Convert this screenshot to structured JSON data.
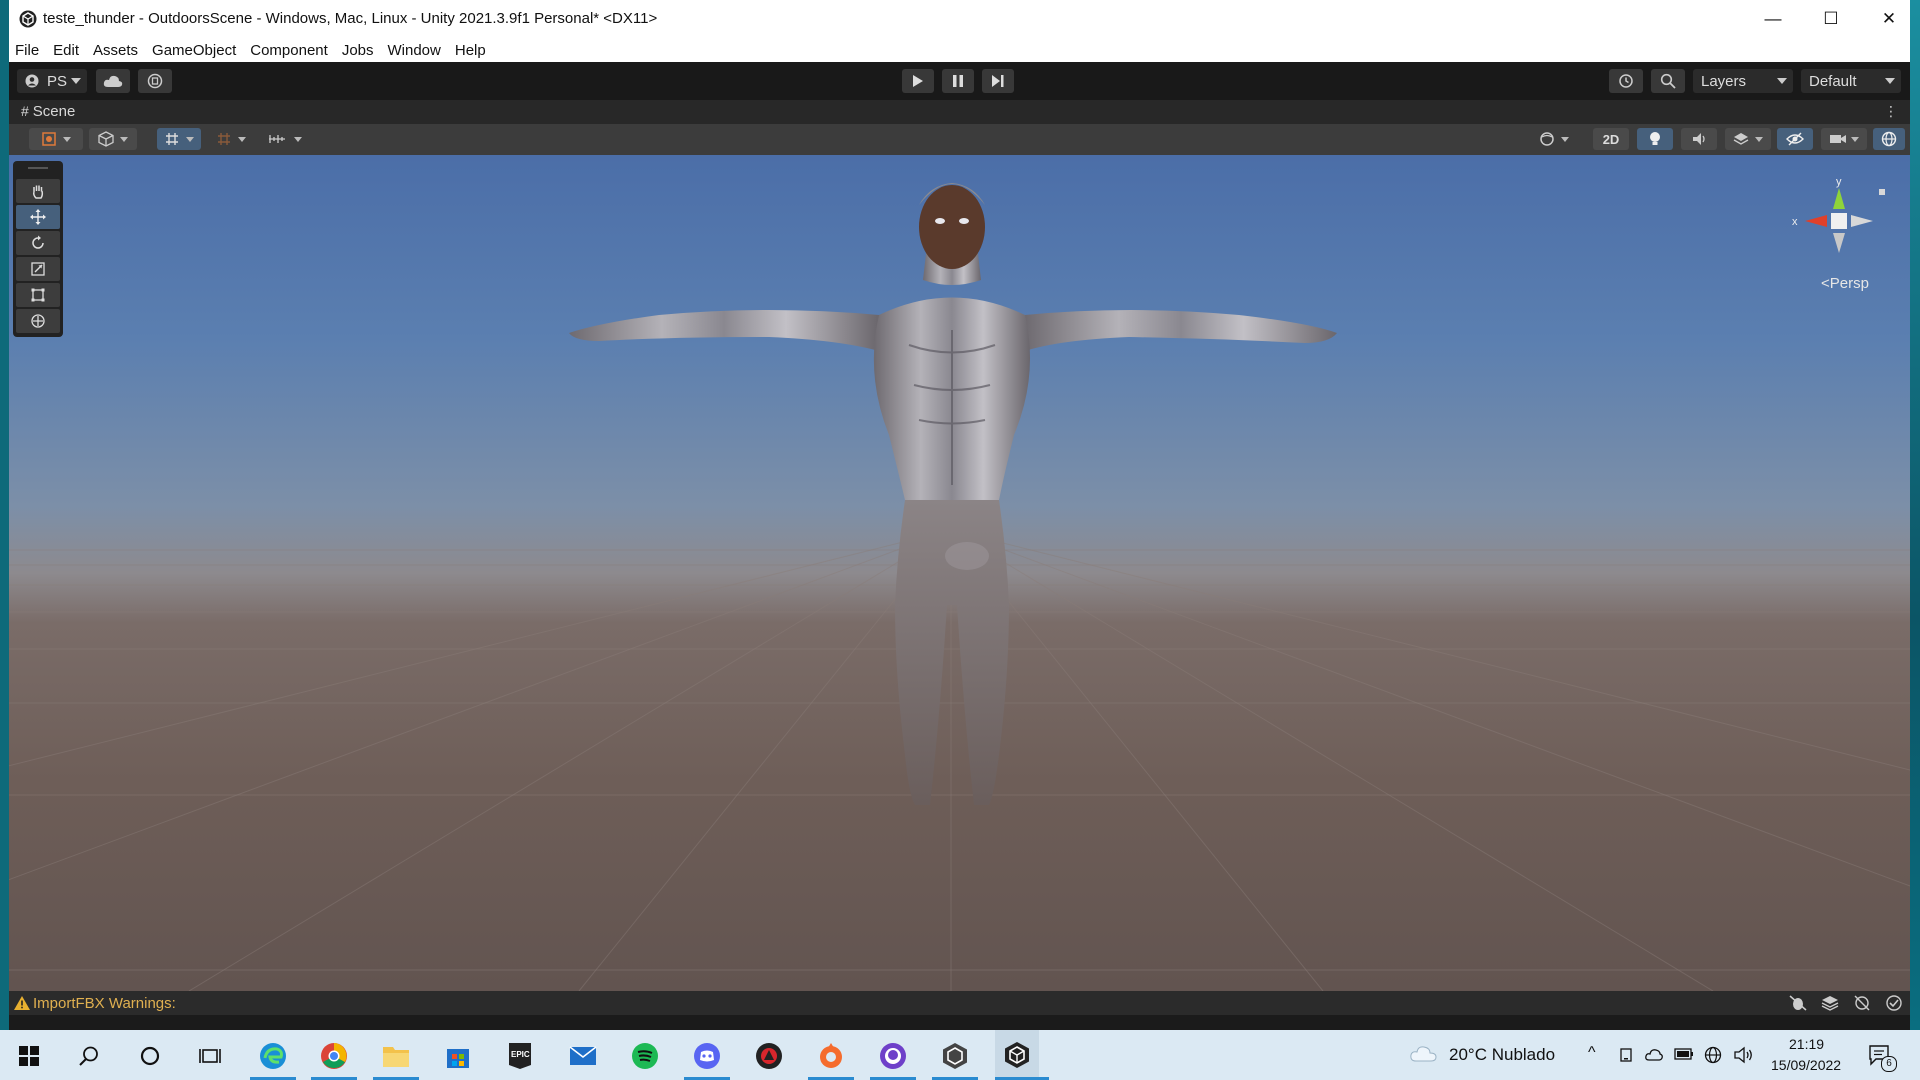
{
  "window": {
    "title": "teste_thunder - OutdoorsScene - Windows, Mac, Linux - Unity 2021.3.9f1 Personal* <DX11>",
    "minimize": "—",
    "maximize": "☐",
    "close": "✕"
  },
  "menu": [
    "File",
    "Edit",
    "Assets",
    "GameObject",
    "Component",
    "Jobs",
    "Window",
    "Help"
  ],
  "toolbar": {
    "account_label": "PS",
    "layers_label": "Layers",
    "layout_label": "Default"
  },
  "scene": {
    "tab_label": "Scene",
    "toggle_2d_label": "2D",
    "persp_label": "Persp",
    "gizmo_y_label": "y",
    "gizmo_x_label": "x"
  },
  "status": {
    "message": "ImportFBX Warnings:"
  },
  "taskbar": {
    "weather_text": "20°C  Nublado",
    "time": "21:19",
    "date": "15/09/2022",
    "notification_count": "6"
  },
  "colors": {
    "accent_active": "#46607c",
    "warning": "#e0b050"
  }
}
